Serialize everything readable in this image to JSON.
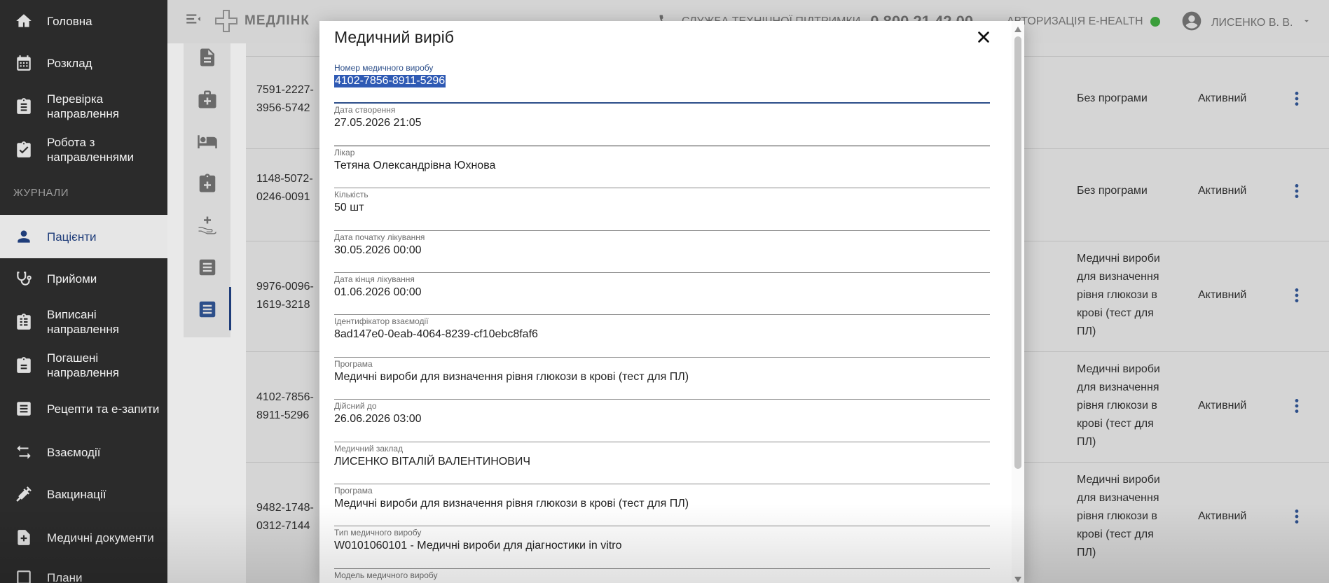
{
  "sidebar": {
    "items": [
      {
        "label": "Головна",
        "icon": "home-icon"
      },
      {
        "label": "Розклад",
        "icon": "calendar-icon"
      },
      {
        "label": "Перевірка направлення",
        "icon": "clipboard-icon"
      },
      {
        "label": "Робота з направленнями",
        "icon": "clipboard-check-icon"
      },
      {
        "label": "Пацієнти",
        "icon": "person-icon"
      },
      {
        "label": "Прийоми",
        "icon": "stethoscope-icon"
      },
      {
        "label": "Виписані направлення",
        "icon": "clipboard-list-icon"
      },
      {
        "label": "Погашені направлення",
        "icon": "clipboard-done-icon"
      },
      {
        "label": "Рецепти та е-запити",
        "icon": "list-icon"
      },
      {
        "label": "Взаємодії",
        "icon": "swap-icon"
      },
      {
        "label": "Вакцинації",
        "icon": "syringe-icon"
      },
      {
        "label": "Медичні документи",
        "icon": "document-plus-icon"
      },
      {
        "label": "Плани",
        "icon": "plan-icon"
      }
    ],
    "section_label": "ЖУРНАЛИ",
    "active_color": "#1f3d7a"
  },
  "topbar": {
    "logo_text": "МЕДЛІНК",
    "support_label": "СЛУЖБА ТЕХНІЧНОЇ ПІДТРИМКИ",
    "support_phone": "0 800 21 42 00",
    "ehealth_label": "АВТОРИЗАЦІЯ E-HEALTH",
    "ehealth_status_color": "#3b9e3b",
    "user_name": "ЛИСЕНКО В. В."
  },
  "table": {
    "rows": [
      {
        "number": "7591-2227-3956-5742",
        "program": "Без програми",
        "status": "Активний"
      },
      {
        "number": "1148-5072-0246-0091",
        "program": "Без програми",
        "status": "Активний"
      },
      {
        "number": "9976-0096-1619-3218",
        "program": "Медичні вироби для визначення рівня глюкози в крові (тест для ПЛ)",
        "status": "Активний"
      },
      {
        "number": "4102-7856-8911-5296",
        "program": "Медичні вироби для визначення рівня глюкози в крові (тест для ПЛ)",
        "status": "Активний"
      },
      {
        "number": "9482-1748-0312-7144",
        "program": "Медичні вироби для визначення рівня глюкози в крові (тест для ПЛ)",
        "status": "Активний"
      }
    ]
  },
  "modal": {
    "title": "Медичний виріб",
    "fields": [
      {
        "label": "Номер медичного виробу",
        "value": "4102-7856-8911-5296"
      },
      {
        "label": "Дата створення",
        "value": "27.05.2026 21:05"
      },
      {
        "label": "Лікар",
        "value": "Тетяна Олександрівна Юхнова"
      },
      {
        "label": "Кількість",
        "value": "50 шт"
      },
      {
        "label": "Дата початку лікування",
        "value": "30.05.2026 00:00"
      },
      {
        "label": "Дата кінця лікування",
        "value": "01.06.2026 00:00"
      },
      {
        "label": "Ідентифікатор взаємодії",
        "value": "8ad147e0-0eab-4064-8239-cf10ebc8faf6"
      },
      {
        "label": "Програма",
        "value": "Медичні вироби для визначення рівня глюкози в крові (тест для ПЛ)"
      },
      {
        "label": "Дійсний до",
        "value": "26.06.2026 03:00"
      },
      {
        "label": "Медичний заклад",
        "value": "ЛИСЕНКО ВІТАЛІЙ ВАЛЕНТИНОВИЧ"
      },
      {
        "label": "Програма",
        "value": "Медичні вироби для визначення рівня глюкози в крові (тест для ПЛ)"
      },
      {
        "label": "Тип медичного виробу",
        "value": "W0101060101 - Медичні вироби для діагностики in vitro"
      },
      {
        "label": "Модель медичного виробу",
        "value": ""
      }
    ],
    "accent_color": "#2d4f8a",
    "selection_color": "#2f5ab4"
  }
}
